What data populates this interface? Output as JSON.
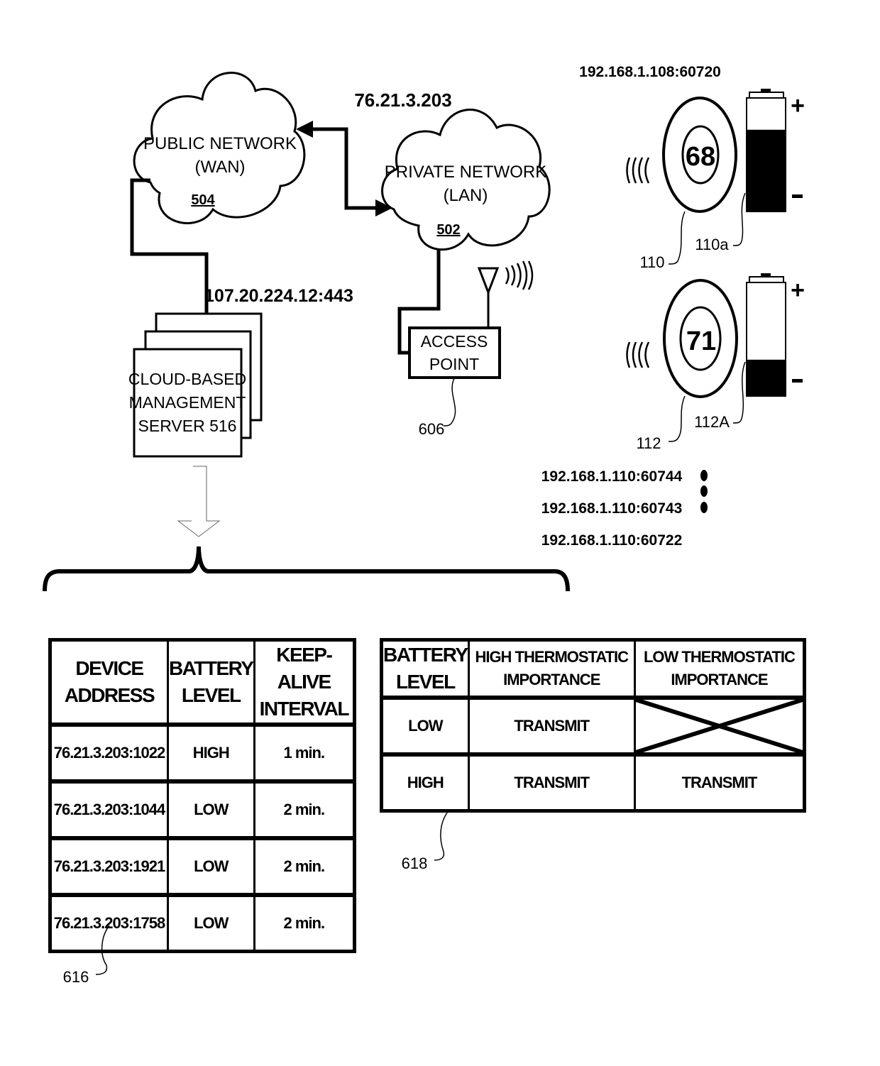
{
  "networks": {
    "public": {
      "line1": "PUBLIC NETWORK",
      "line2": "(WAN)",
      "ref": "504"
    },
    "private": {
      "line1": "PRIVATE NETWORK",
      "line2": "(LAN)",
      "ref": "502",
      "ip": "76.21.3.203"
    }
  },
  "server": {
    "line1": "CLOUD-BASED",
    "line2": "MANAGEMENT",
    "line3": "SERVER 516",
    "address": "107.20.224.12:443"
  },
  "access_point": {
    "line1": "ACCESS",
    "line2": "POINT",
    "ref": "606"
  },
  "thermostats": [
    {
      "address": "192.168.1.108:60720",
      "temperature": "68",
      "ref": "110",
      "battery_ref": "110a",
      "battery_level_fraction": 0.72
    },
    {
      "temperature": "71",
      "ref": "112",
      "battery_ref": "112A",
      "battery_level_fraction": 0.32
    }
  ],
  "battery_signs": {
    "plus": "+",
    "minus": "-"
  },
  "connection_addresses": [
    "192.168.1.110:60744",
    "192.168.1.110:60743",
    "192.168.1.110:60722"
  ],
  "table_616": {
    "ref": "616",
    "headers": [
      {
        "line1": "DEVICE",
        "line2": "ADDRESS"
      },
      {
        "line1": "BATTERY",
        "line2": "LEVEL"
      },
      {
        "line1": "KEEP-ALIVE",
        "line2": "INTERVAL"
      }
    ],
    "rows": [
      [
        "76.21.3.203:1022",
        "HIGH",
        "1 min."
      ],
      [
        "76.21.3.203:1044",
        "LOW",
        "2 min."
      ],
      [
        "76.21.3.203:1921",
        "LOW",
        "2 min."
      ],
      [
        "76.21.3.203:1758",
        "LOW",
        "2 min."
      ]
    ]
  },
  "table_618": {
    "ref": "618",
    "headers": [
      {
        "line1": "BATTERY",
        "line2": "LEVEL"
      },
      {
        "line1": "HIGH THERMOSTATIC",
        "line2": "IMPORTANCE"
      },
      {
        "line1": "LOW THERMOSTATIC",
        "line2": "IMPORTANCE"
      }
    ],
    "rows": [
      [
        "LOW",
        "TRANSMIT",
        ""
      ],
      [
        "HIGH",
        "TRANSMIT",
        "TRANSMIT"
      ]
    ],
    "crossed_cell": "row 1, column 3 (no transmit)"
  }
}
